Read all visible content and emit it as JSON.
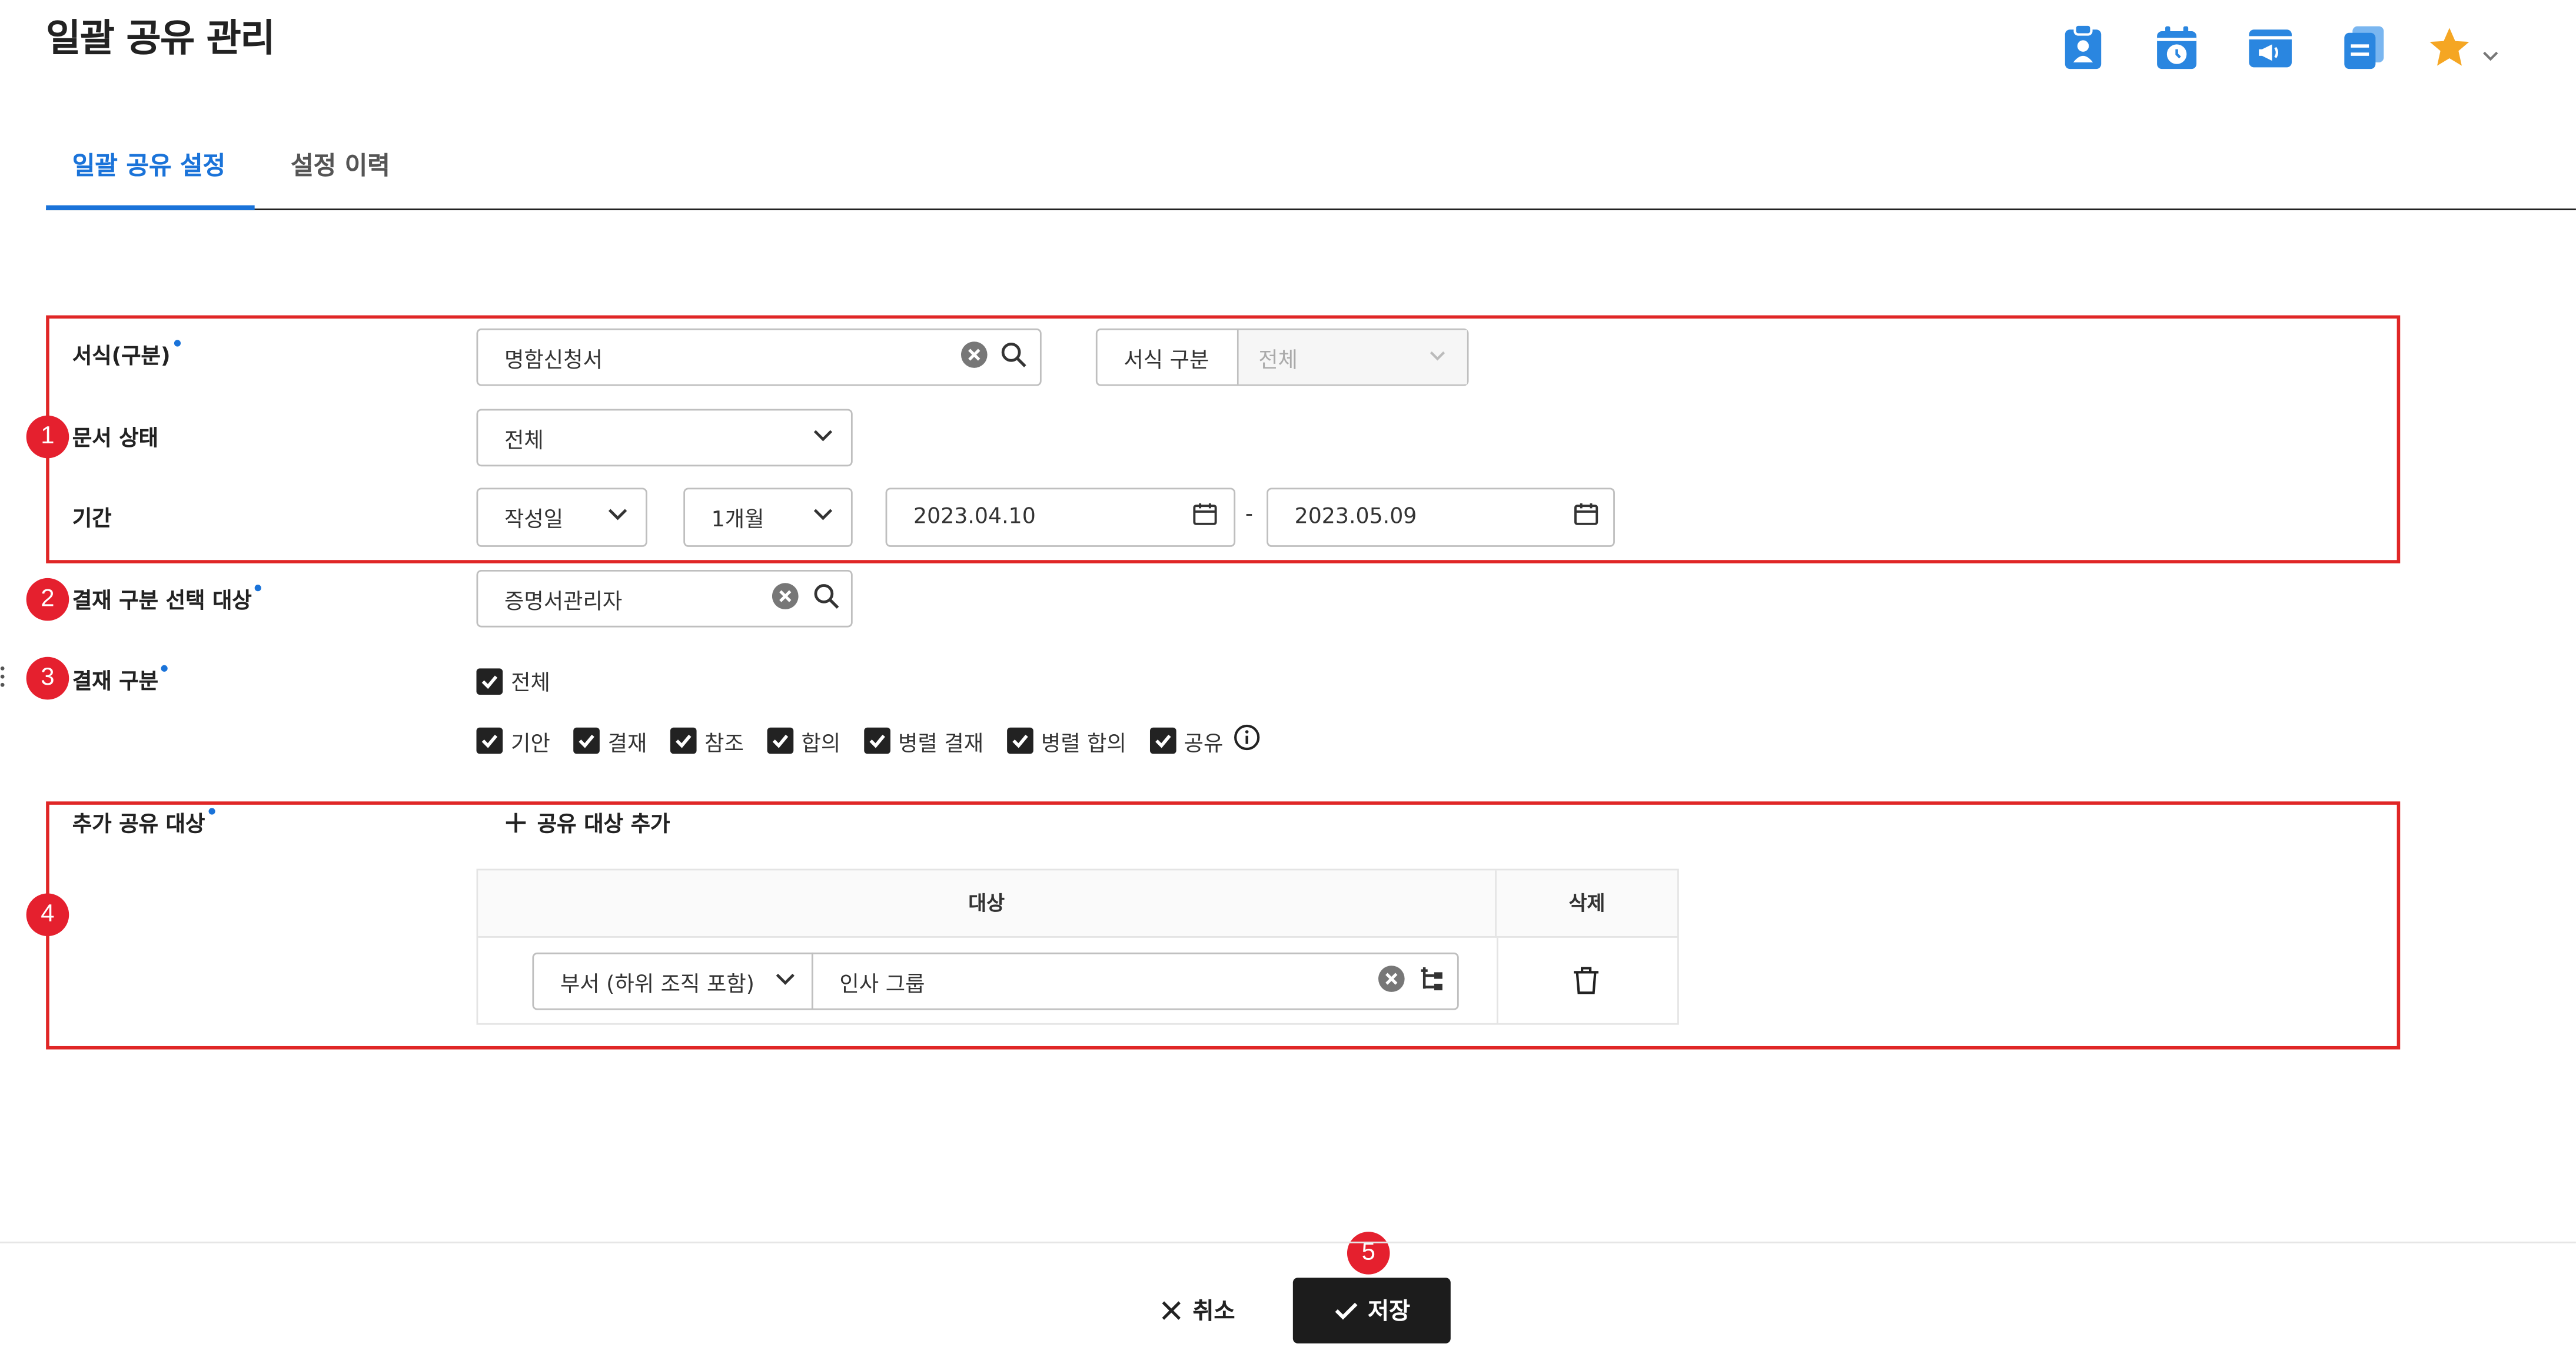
{
  "page": {
    "title": "일괄 공유 관리"
  },
  "header_icons": [
    "profile-clipboard-icon",
    "calendar-clock-icon",
    "megaphone-window-icon",
    "document-stack-icon",
    "star-icon",
    "chevron-down-icon"
  ],
  "colors": {
    "accent": "#1a73d9",
    "annotation_red": "#e02626",
    "save_button": "#1c1c1c"
  },
  "tabs": [
    {
      "label": "일괄 공유 설정",
      "active": true
    },
    {
      "label": "설정 이력",
      "active": false
    }
  ],
  "annotations": [
    "1",
    "2",
    "3",
    "4",
    "5"
  ],
  "form": {
    "format": {
      "label": "서식(구분)",
      "value": "명함신청서",
      "type_label": "서식 구분",
      "type_value": "전체"
    },
    "doc_status": {
      "label": "문서 상태",
      "value": "전체"
    },
    "period": {
      "label": "기간",
      "basis": "작성일",
      "range": "1개월",
      "start": "2023.04.10",
      "separator": "-",
      "end": "2023.05.09"
    },
    "approval_target": {
      "label": "결재 구분 선택 대상",
      "value": "증명서관리자"
    },
    "approval_type": {
      "label": "결재 구분",
      "all": "전체",
      "options": [
        "기안",
        "결재",
        "참조",
        "합의",
        "병렬 결재",
        "병렬 합의",
        "공유"
      ]
    },
    "extra_share": {
      "label": "추가 공유 대상",
      "add_button": "공유 대상 추가",
      "table": {
        "headers": [
          "대상",
          "삭제"
        ],
        "rows": [
          {
            "scope": "부서 (하위 조직 포함)",
            "target": "인사 그룹"
          }
        ]
      }
    }
  },
  "footer": {
    "cancel": "취소",
    "save": "저장"
  }
}
